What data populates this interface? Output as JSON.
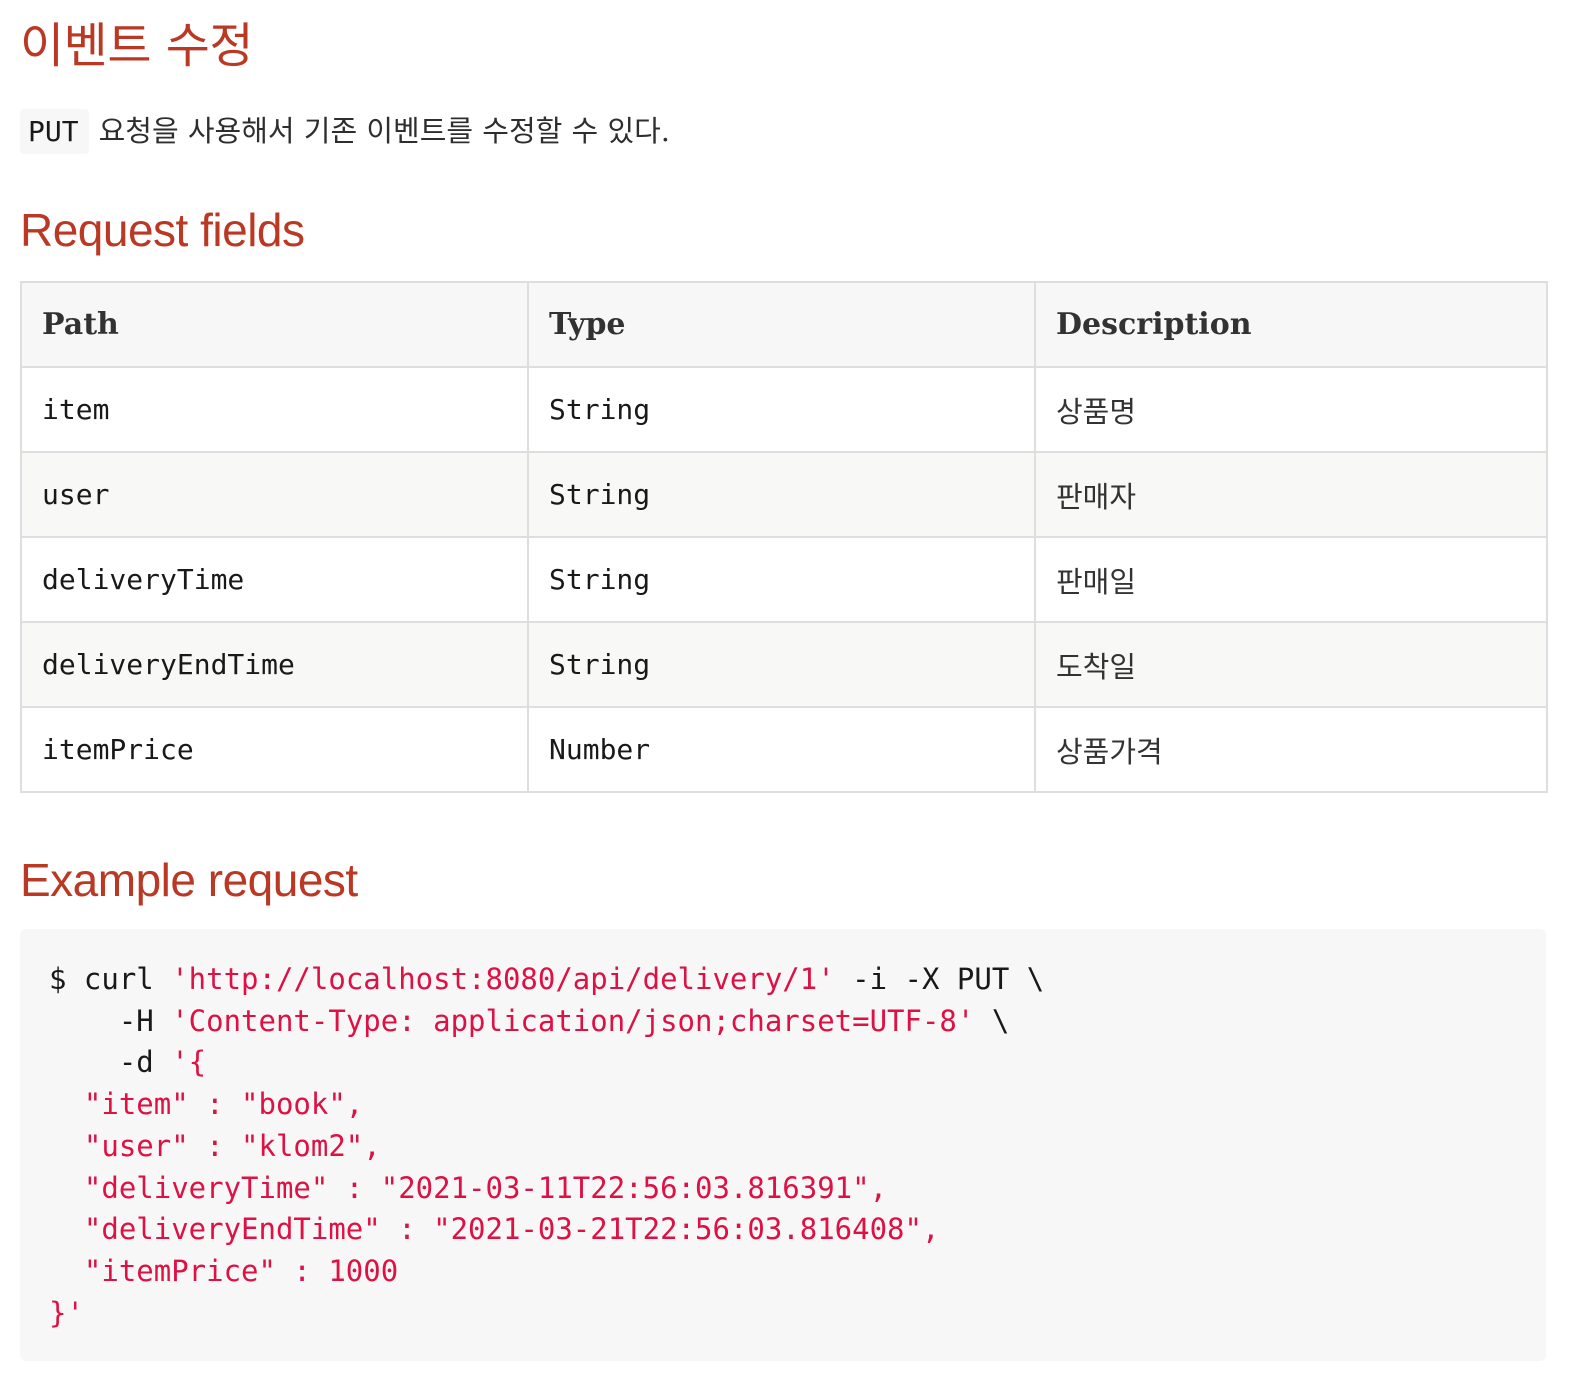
{
  "title": "이벤트 수정",
  "intro": {
    "method": "PUT",
    "text": "요청을 사용해서 기존 이벤트를 수정할 수 있다."
  },
  "request_fields": {
    "heading": "Request fields",
    "columns": [
      "Path",
      "Type",
      "Description"
    ],
    "rows": [
      {
        "path": "item",
        "type": "String",
        "description": "상품명"
      },
      {
        "path": "user",
        "type": "String",
        "description": "판매자"
      },
      {
        "path": "deliveryTime",
        "type": "String",
        "description": "판매일"
      },
      {
        "path": "deliveryEndTime",
        "type": "String",
        "description": "도착일"
      },
      {
        "path": "itemPrice",
        "type": "Number",
        "description": "상품가격"
      }
    ]
  },
  "example_request": {
    "heading": "Example request",
    "lines": [
      {
        "plain": "$ curl ",
        "str": "'http://localhost:8080/api/delivery/1'",
        "tail": " -i -X PUT \\"
      },
      {
        "plain": "    -H ",
        "str": "'Content-Type: application/json;charset=UTF-8'",
        "tail": " \\"
      },
      {
        "plain": "    -d ",
        "str": "'{",
        "tail": ""
      },
      {
        "plain": "",
        "str": "  \"item\" : \"book\",",
        "tail": ""
      },
      {
        "plain": "",
        "str": "  \"user\" : \"klom2\",",
        "tail": ""
      },
      {
        "plain": "",
        "str": "  \"deliveryTime\" : \"2021-03-11T22:56:03.816391\",",
        "tail": ""
      },
      {
        "plain": "",
        "str": "  \"deliveryEndTime\" : \"2021-03-21T22:56:03.816408\",",
        "tail": ""
      },
      {
        "plain": "",
        "str": "  \"itemPrice\" : 1000",
        "tail": ""
      },
      {
        "plain": "",
        "str": "}'",
        "tail": ""
      }
    ]
  },
  "colors": {
    "heading": "#ba3925",
    "code_string": "#dd1144",
    "code_background": "#f7f7f8",
    "table_border": "#dedede"
  }
}
